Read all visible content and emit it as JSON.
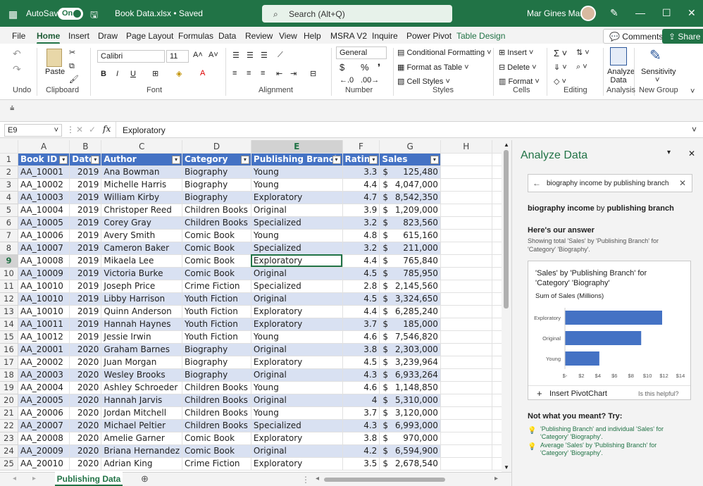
{
  "titlebar": {
    "autosave_label": "AutoSave",
    "toggle_state": "On",
    "filename": "Book Data.xlsx • Saved",
    "search_placeholder": "Search (Alt+Q)",
    "user_name": "Mar Gines Marin"
  },
  "tabs": [
    "File",
    "Home",
    "Insert",
    "Draw",
    "Page Layout",
    "Formulas",
    "Data",
    "Review",
    "View",
    "Help",
    "MSRA V2",
    "Inquire",
    "Power Pivot",
    "Table Design"
  ],
  "header_buttons": {
    "comments": "Comments",
    "share": "Share"
  },
  "ribbon": {
    "font_name": "Calibri",
    "font_size": "11",
    "number_format": "General",
    "labels": {
      "paste": "Paste",
      "cond_format": "Conditional Formatting",
      "format_table": "Format as Table",
      "cell_styles": "Cell Styles",
      "insert": "Insert",
      "delete": "Delete",
      "format": "Format",
      "analyze": "Analyze Data",
      "sensitivity": "Sensitivity"
    },
    "groups": {
      "undo": "Undo",
      "clipboard": "Clipboard",
      "font": "Font",
      "alignment": "Alignment",
      "number": "Number",
      "styles": "Styles",
      "cells": "Cells",
      "editing": "Editing",
      "analysis": "Analysis",
      "newgroup": "New Group"
    }
  },
  "formula_bar": {
    "name_box": "E9",
    "formula": "Exploratory"
  },
  "grid": {
    "col_letters": [
      "A",
      "B",
      "C",
      "D",
      "E",
      "F",
      "G",
      "H"
    ],
    "headers": [
      "Book ID",
      "Date",
      "Author",
      "Category",
      "Publishing Branch",
      "Rating",
      "Sales"
    ],
    "rows": [
      [
        "AA_10001",
        "2019",
        "Ana Bowman",
        "Biography",
        "Young",
        "3.3",
        "125,480"
      ],
      [
        "AA_10002",
        "2019",
        "Michelle Harris",
        "Biography",
        "Young",
        "4.4",
        "4,047,000"
      ],
      [
        "AA_10003",
        "2019",
        "William Kirby",
        "Biography",
        "Exploratory",
        "4.7",
        "8,542,350"
      ],
      [
        "AA_10004",
        "2019",
        "Christoper Reed",
        "Children Books",
        "Original",
        "3.9",
        "1,209,000"
      ],
      [
        "AA_10005",
        "2019",
        "Corey Gray",
        "Children Books",
        "Specialized",
        "3.2",
        "823,560"
      ],
      [
        "AA_10006",
        "2019",
        "Avery Smith",
        "Comic Book",
        "Young",
        "4.8",
        "615,160"
      ],
      [
        "AA_10007",
        "2019",
        "Cameron Baker",
        "Comic Book",
        "Specialized",
        "3.2",
        "211,000"
      ],
      [
        "AA_10008",
        "2019",
        "Mikaela Lee",
        "Comic Book",
        "Exploratory",
        "4.4",
        "765,840"
      ],
      [
        "AA_10009",
        "2019",
        "Victoria Burke",
        "Comic Book",
        "Original",
        "4.5",
        "785,950"
      ],
      [
        "AA_10010",
        "2019",
        "Joseph Price",
        "Crime Fiction",
        "Specialized",
        "2.8",
        "2,145,560"
      ],
      [
        "AA_10010",
        "2019",
        "Libby Harrison",
        "Youth Fiction",
        "Original",
        "4.5",
        "3,324,650"
      ],
      [
        "AA_10010",
        "2019",
        "Quinn Anderson",
        "Youth Fiction",
        "Exploratory",
        "4.4",
        "6,285,240"
      ],
      [
        "AA_10011",
        "2019",
        "Hannah Haynes",
        "Youth Fiction",
        "Exploratory",
        "3.7",
        "185,000"
      ],
      [
        "AA_10012",
        "2019",
        "Jessie Irwin",
        "Youth Fiction",
        "Young",
        "4.6",
        "7,546,820"
      ],
      [
        "AA_20001",
        "2020",
        "Graham Barnes",
        "Biography",
        "Original",
        "3.8",
        "2,303,000"
      ],
      [
        "AA_20002",
        "2020",
        "Juan Morgan",
        "Biography",
        "Exploratory",
        "4.5",
        "3,239,964"
      ],
      [
        "AA_20003",
        "2020",
        "Wesley Brooks",
        "Biography",
        "Original",
        "4.3",
        "6,933,264"
      ],
      [
        "AA_20004",
        "2020",
        "Ashley Schroeder",
        "Children Books",
        "Young",
        "4.6",
        "1,148,850"
      ],
      [
        "AA_20005",
        "2020",
        "Hannah Jarvis",
        "Children Books",
        "Original",
        "4",
        "5,310,000"
      ],
      [
        "AA_20006",
        "2020",
        "Jordan Mitchell",
        "Children Books",
        "Young",
        "3.7",
        "3,120,000"
      ],
      [
        "AA_20007",
        "2020",
        "Michael Peltier",
        "Children Books",
        "Specialized",
        "4.3",
        "6,993,000"
      ],
      [
        "AA_20008",
        "2020",
        "Amelie Garner",
        "Comic Book",
        "Exploratory",
        "3.8",
        "970,000"
      ],
      [
        "AA_20009",
        "2020",
        "Briana Hernandez",
        "Comic Book",
        "Original",
        "4.2",
        "6,594,900"
      ],
      [
        "AA_20010",
        "2020",
        "Adrian King",
        "Crime Fiction",
        "Exploratory",
        "3.5",
        "2,678,540"
      ]
    ],
    "currency": "$",
    "sheet_tab": "Publishing Data"
  },
  "panel": {
    "title": "Analyze Data",
    "query": "biography income by publishing branch",
    "result_title_parts": [
      "biography income",
      " by ",
      "publishing branch"
    ],
    "answer_label": "Here's our answer",
    "answer_desc": "Showing total 'Sales' by 'Publishing Branch' for 'Category' 'Biography'.",
    "card_title": "'Sales' by 'Publishing Branch' for 'Category' 'Biography'",
    "card_subtitle": "Sum of Sales (Millions)",
    "insert_pivot": "Insert PivotChart",
    "helpful": "Is this helpful?",
    "not_meant": "Not what you meant? Try:",
    "suggestions": [
      "'Publishing Branch' and individual 'Sales' for 'Category' 'Biography'.",
      "Average 'Sales' by 'Publishing Branch' for 'Category' 'Biography'."
    ]
  },
  "chart_data": {
    "type": "bar",
    "orientation": "horizontal",
    "categories": [
      "Exploratory",
      "Original",
      "Young"
    ],
    "values": [
      11.78,
      9.24,
      4.17
    ],
    "ylabel": "Sum of Sales (Millions)",
    "xticks": [
      "$-",
      "$2",
      "$4",
      "$6",
      "$8",
      "$10",
      "$12",
      "$14"
    ],
    "xlim": [
      0,
      14
    ],
    "color": "#4472c4"
  }
}
